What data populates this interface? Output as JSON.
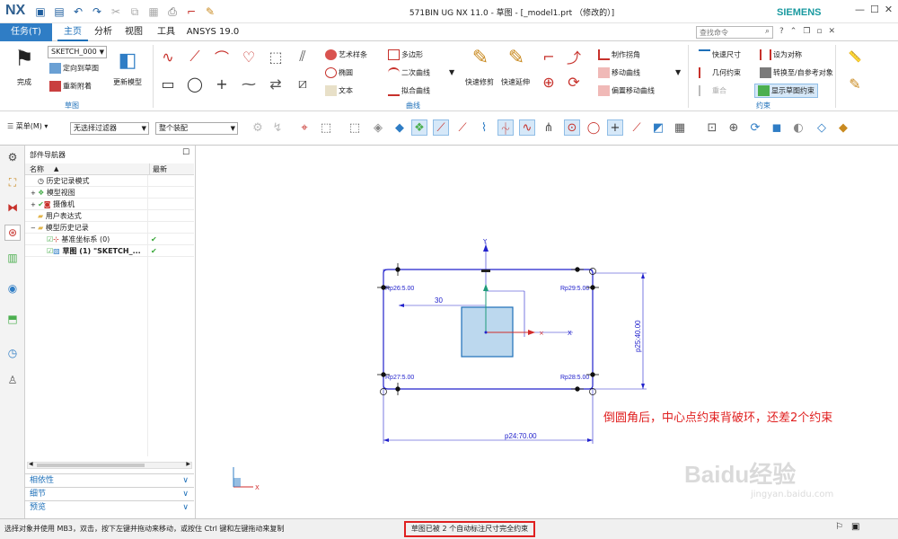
{
  "app": {
    "logo": "NX",
    "title": "571BIN UG NX 11.0 - 草图 - [_model1.prt （修改的）]",
    "brand": "SIEMENS"
  },
  "tabs": [
    "任务(T)",
    "主页",
    "分析",
    "视图",
    "工具",
    "ANSYS 19.0"
  ],
  "search": {
    "placeholder": "查找命令"
  },
  "ribbon": {
    "finish": "完成",
    "sketch_name": "SKETCH_000",
    "orient": "定向到草图",
    "reattach": "重新附着",
    "update_model": "更新模型",
    "group_sketch": "草图",
    "art_spline": "艺术样条",
    "polygon": "多边形",
    "ellipse": "椭圆",
    "conic": "二次曲线",
    "text": "文本",
    "fit_curve": "拟合曲线",
    "quick_trim": "快速修剪",
    "quick_extend": "快速延伸",
    "make_corner": "制作拐角",
    "move_curve": "移动曲线",
    "offset_move": "偏置移动曲线",
    "group_curve": "曲线",
    "quick_dim": "快速尺寸",
    "set_symmetric": "设为对称",
    "geo_constraint": "几何约束",
    "convert_ref": "转换至/自参考对象",
    "overlay": "重合",
    "show_constraints": "显示草图约束",
    "group_constraint": "约束"
  },
  "toolbar": {
    "menu": "菜单(M)",
    "filter": "无选择过滤器",
    "assembly": "整个装配"
  },
  "navigator": {
    "title": "部件导航器",
    "col_name": "名称",
    "col_latest": "最新",
    "rows": [
      "历史记录模式",
      "模型视图",
      "摄像机",
      "用户表达式",
      "模型历史记录",
      "基准坐标系 (0)",
      "草图 (1) \"SKETCH_..."
    ],
    "sections": [
      "相依性",
      "细节",
      "预览"
    ]
  },
  "sketch": {
    "dim_top": "30",
    "dim_right": "p25:40.00",
    "dim_bottom": "p24:70.00",
    "r_tl": "Rp26:5.00",
    "r_tr": "Rp29:5.00",
    "r_bl": "Rp27:5.00",
    "r_br": "Rp28:5.00"
  },
  "annotation": "倒圆角后，中心点约束背破环，还差2个约束",
  "watermark": {
    "brand": "Baidu经验",
    "url": "jingyan.baidu.com"
  },
  "status": {
    "left": "选择对象并使用 MB3，双击，按下左键并拖动来移动，或按住 Ctrl 键和左键拖动来复制",
    "center": "草图已被 2 个自动标注尺寸完全约束"
  },
  "colors": {
    "accent": "#1d6fb8",
    "tab_active": "#2f7dc5",
    "annotation": "#e02020",
    "status_box": "#e02020",
    "sketch_line": "#2222cc"
  }
}
